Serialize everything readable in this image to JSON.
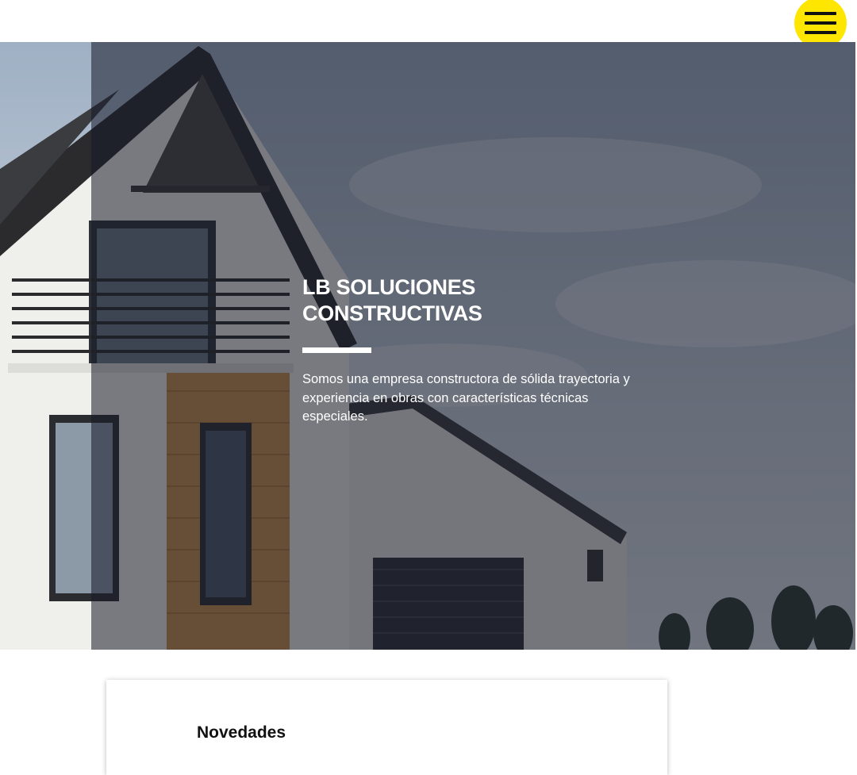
{
  "header": {
    "menu_icon": "hamburger-menu-icon",
    "menu_color": "#ffe600"
  },
  "hero": {
    "title_line1": "LB SOLUCIONES",
    "title_line2": "CONSTRUCTIVAS",
    "description": "Somos una empresa constructora de sólida trayectoria y experiencia en obras con características técnicas especiales."
  },
  "news": {
    "title": "Novedades"
  }
}
